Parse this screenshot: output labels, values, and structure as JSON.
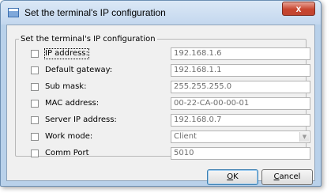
{
  "window": {
    "title": "Set the terminal's IP configuration",
    "close_glyph": "x",
    "icon": "window-app-icon"
  },
  "group": {
    "legend": "Set the terminal's IP configuration"
  },
  "fields": [
    {
      "label": "IP address:",
      "value": "192.168.1.6",
      "checked": false,
      "type": "text"
    },
    {
      "label": "Default gateway:",
      "value": "192.168.1.1",
      "checked": false,
      "type": "text"
    },
    {
      "label": "Sub mask:",
      "value": "255.255.255.0",
      "checked": false,
      "type": "text"
    },
    {
      "label": "MAC address:",
      "value": "00-22-CA-00-00-01",
      "checked": false,
      "type": "text"
    },
    {
      "label": "Server IP address:",
      "value": "192.168.0.7",
      "checked": false,
      "type": "text"
    },
    {
      "label": "Work mode:",
      "value": "Client",
      "checked": false,
      "type": "select"
    },
    {
      "label": "Comm Port",
      "value": "5010",
      "checked": false,
      "type": "text"
    }
  ],
  "buttons": {
    "ok_mnemonic": "O",
    "ok_rest": "K",
    "cancel_mnemonic": "C",
    "cancel_rest": "ancel"
  },
  "colors": {
    "frame": "#b9d1ea",
    "client": "#f0f0f0",
    "field_text": "#6d6d6d",
    "close": "#c8452f"
  }
}
